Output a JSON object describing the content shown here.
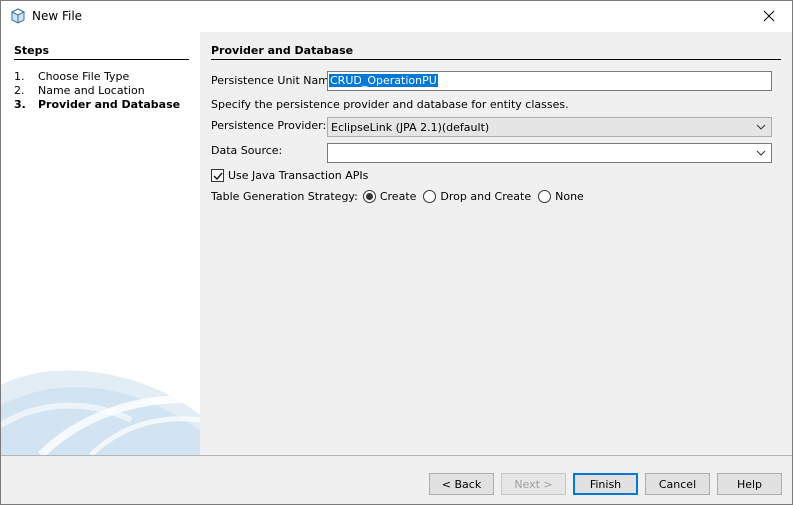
{
  "window": {
    "title": "New File"
  },
  "steps": {
    "heading": "Steps",
    "items": [
      {
        "num": "1.",
        "label": "Choose File Type"
      },
      {
        "num": "2.",
        "label": "Name and Location"
      },
      {
        "num": "3.",
        "label": "Provider and Database"
      }
    ],
    "current_index": 2
  },
  "content": {
    "heading": "Provider and Database",
    "persistence_unit_label": "Persistence Unit Name:",
    "persistence_unit_value": "CRUD_OperationPU",
    "instructions": "Specify the persistence provider and database for entity classes.",
    "provider_label": "Persistence Provider:",
    "provider_value": "EclipseLink (JPA 2.1)(default)",
    "datasource_label": "Data Source:",
    "datasource_value": "",
    "jta_label": "Use Java Transaction APIs",
    "jta_checked": true,
    "table_strategy_label": "Table Generation Strategy:",
    "table_strategy_options": [
      "Create",
      "Drop and Create",
      "None"
    ],
    "table_strategy_selected": "Create"
  },
  "buttons": {
    "back": "< Back",
    "next": "Next >",
    "finish": "Finish",
    "cancel": "Cancel",
    "help": "Help"
  },
  "colors": {
    "selection": "#0078d7",
    "panel_background": "#f0f0f0",
    "disabled_text": "#a0a0a0"
  }
}
